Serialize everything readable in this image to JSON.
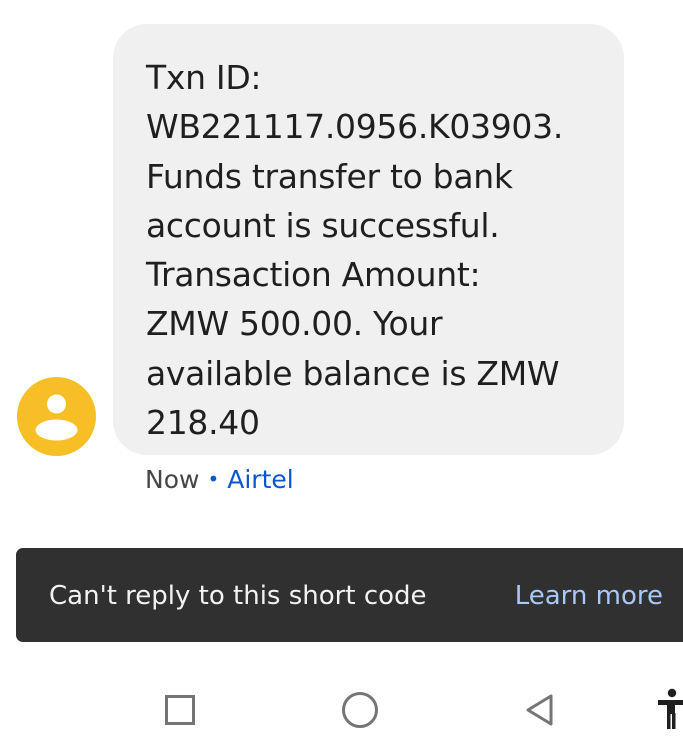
{
  "conversation": {
    "message": {
      "text": "Txn ID:\nWB221117.0956.K03903.\nFunds transfer to bank\naccount is successful.\nTransaction Amount:\nZMW 500.00. Your\navailable balance is ZMW\n218.40",
      "time": "Now",
      "separator": "•",
      "sender": "Airtel"
    },
    "avatar": {
      "icon": "person-icon",
      "color": "#f6bf26"
    }
  },
  "snackbar": {
    "message": "Can't reply to this short code",
    "action_label": "Learn more"
  },
  "navigation_bar": {
    "buttons": [
      "recents-button",
      "home-button",
      "back-button",
      "accessibility-button"
    ]
  },
  "colors": {
    "bubble": "#f0f0f0",
    "accent": "#0b57d0",
    "snackbar": "#303030",
    "snackbar_action": "#a8c7fa"
  }
}
